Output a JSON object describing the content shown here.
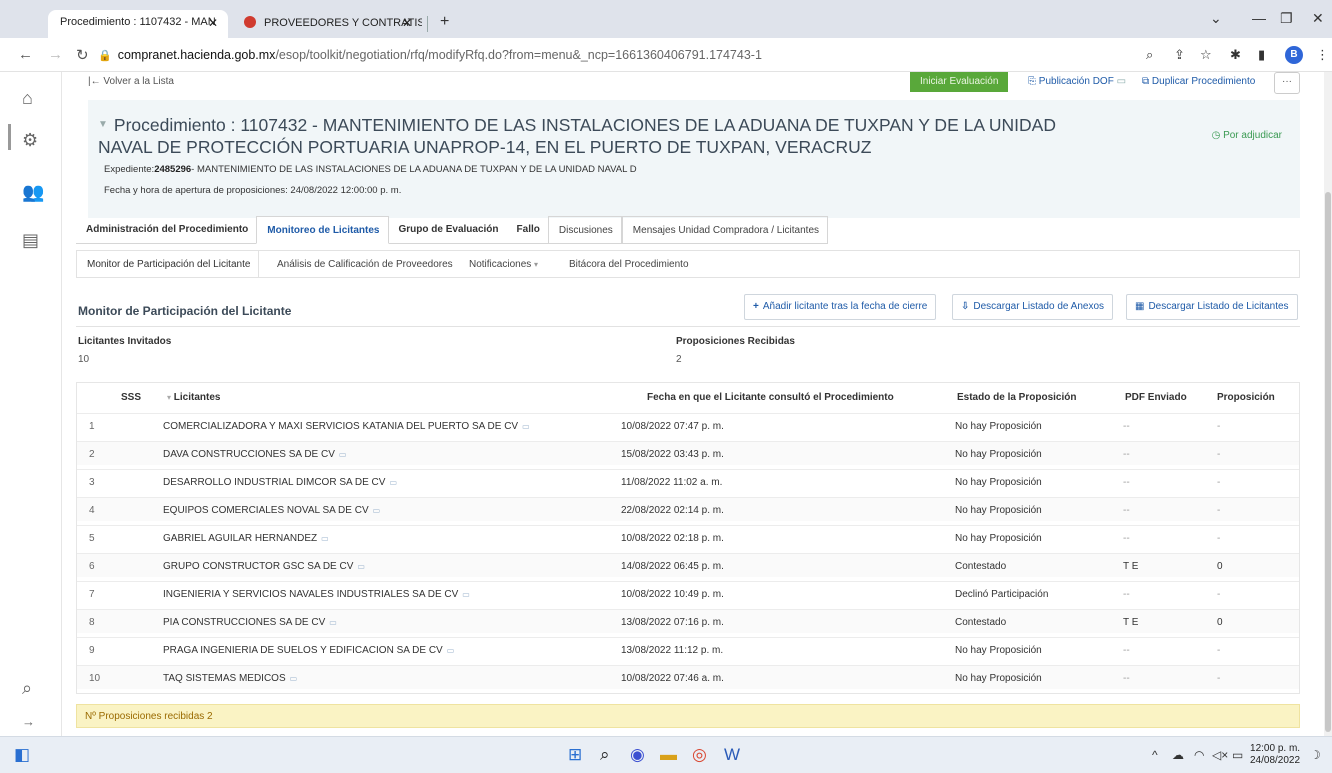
{
  "browser": {
    "tabs": [
      {
        "label": "Procedimiento : 1107432 - MAN",
        "active": true
      },
      {
        "label": "PROVEEDORES Y CONTRATISTAS",
        "active": false
      }
    ],
    "url_domain": "compranet.hacienda.gob.mx",
    "url_path": "/esop/toolkit/negotiation/rfq/modifyRfq.do?from=menu&_ncp=1661360406791.174743-1",
    "profile_initial": "B"
  },
  "toolbar": {
    "back_label": "Volver a la Lista",
    "start_eval": "Iniciar Evaluación",
    "publish_dof": "Publicación DOF",
    "duplicate": "Duplicar Procedimiento",
    "more": "···"
  },
  "header": {
    "title": "Procedimiento : 1107432 - MANTENIMIENTO DE LAS INSTALACIONES DE LA ADUANA DE TUXPAN Y DE LA UNIDAD NAVAL DE PROTECCIÓN PORTUARIA UNAPROP-14, EN EL PUERTO DE TUXPAN, VERACRUZ",
    "status": "Por adjudicar",
    "expediente_label": "Expediente:",
    "expediente_number": "2485296",
    "expediente_text": "- MANTENIMIENTO DE LAS INSTALACIONES DE LA ADUANA DE TUXPAN Y DE LA UNIDAD NAVAL D",
    "fecha": "Fecha y hora de apertura de proposiciones: 24/08/2022 12:00:00 p. m."
  },
  "tabs_main": [
    "Administración del Procedimiento",
    "Monitoreo de Licitantes",
    "Grupo de Evaluación",
    "Fallo",
    "Discusiones",
    "Mensajes Unidad Compradora / Licitantes"
  ],
  "tabs_sub": [
    "Monitor de Participación del Licitante",
    "Análisis de Calificación de Proveedores",
    "Notificaciones",
    "Bitácora del Procedimiento"
  ],
  "section": {
    "title": "Monitor de Participación del Licitante",
    "add_button": "Añadir licitante tras la fecha de cierre",
    "download_annex": "Descargar Listado de Anexos",
    "download_bidders": "Descargar Listado de Licitantes"
  },
  "stats": {
    "invited_label": "Licitantes Invitados",
    "invited_value": "10",
    "received_label": "Proposiciones Recibidas",
    "received_value": "2"
  },
  "table": {
    "headers": [
      "SSS",
      "Licitantes",
      "Fecha en que el Licitante consultó el Procedimiento",
      "Estado de la Proposición",
      "PDF Enviado",
      "Proposición"
    ],
    "rows": [
      {
        "n": "1",
        "name": "COMERCIALIZADORA Y MAXI SERVICIOS KATANIA DEL PUERTO SA DE CV",
        "date": "10/08/2022 07:47 p. m.",
        "status": "No hay Proposición",
        "pdf": "--",
        "prop": "-"
      },
      {
        "n": "2",
        "name": "DAVA CONSTRUCCIONES SA DE CV",
        "date": "15/08/2022 03:43 p. m.",
        "status": "No hay Proposición",
        "pdf": "--",
        "prop": "-"
      },
      {
        "n": "3",
        "name": "DESARROLLO INDUSTRIAL DIMCOR SA DE CV",
        "date": "11/08/2022 11:02 a. m.",
        "status": "No hay Proposición",
        "pdf": "--",
        "prop": "-"
      },
      {
        "n": "4",
        "name": "EQUIPOS COMERCIALES NOVAL SA DE CV",
        "date": "22/08/2022 02:14 p. m.",
        "status": "No hay Proposición",
        "pdf": "--",
        "prop": "-"
      },
      {
        "n": "5",
        "name": "GABRIEL AGUILAR HERNANDEZ",
        "date": "10/08/2022 02:18 p. m.",
        "status": "No hay Proposición",
        "pdf": "--",
        "prop": "-"
      },
      {
        "n": "6",
        "name": "GRUPO CONSTRUCTOR GSC SA DE CV",
        "date": "14/08/2022 06:45 p. m.",
        "status": "Contestado",
        "pdf": "T E",
        "prop": "0"
      },
      {
        "n": "7",
        "name": "INGENIERIA Y SERVICIOS NAVALES INDUSTRIALES SA DE CV",
        "date": "10/08/2022 10:49 p. m.",
        "status": "Declinó Participación",
        "pdf": "--",
        "prop": "-"
      },
      {
        "n": "8",
        "name": "PIA CONSTRUCCIONES SA DE CV",
        "date": "13/08/2022 07:16 p. m.",
        "status": "Contestado",
        "pdf": "T E",
        "prop": "0"
      },
      {
        "n": "9",
        "name": "PRAGA INGENIERIA DE SUELOS Y EDIFICACION SA DE CV",
        "date": "13/08/2022 11:12 p. m.",
        "status": "No hay Proposición",
        "pdf": "--",
        "prop": "-"
      },
      {
        "n": "10",
        "name": "TAQ SISTEMAS MEDICOS",
        "date": "10/08/2022 07:46 a. m.",
        "status": "No hay Proposición",
        "pdf": "--",
        "prop": "-"
      }
    ]
  },
  "footer": "Nº Proposiciones recibidas 2",
  "taskbar": {
    "time": "12:00 p. m.",
    "date": "24/08/2022"
  }
}
